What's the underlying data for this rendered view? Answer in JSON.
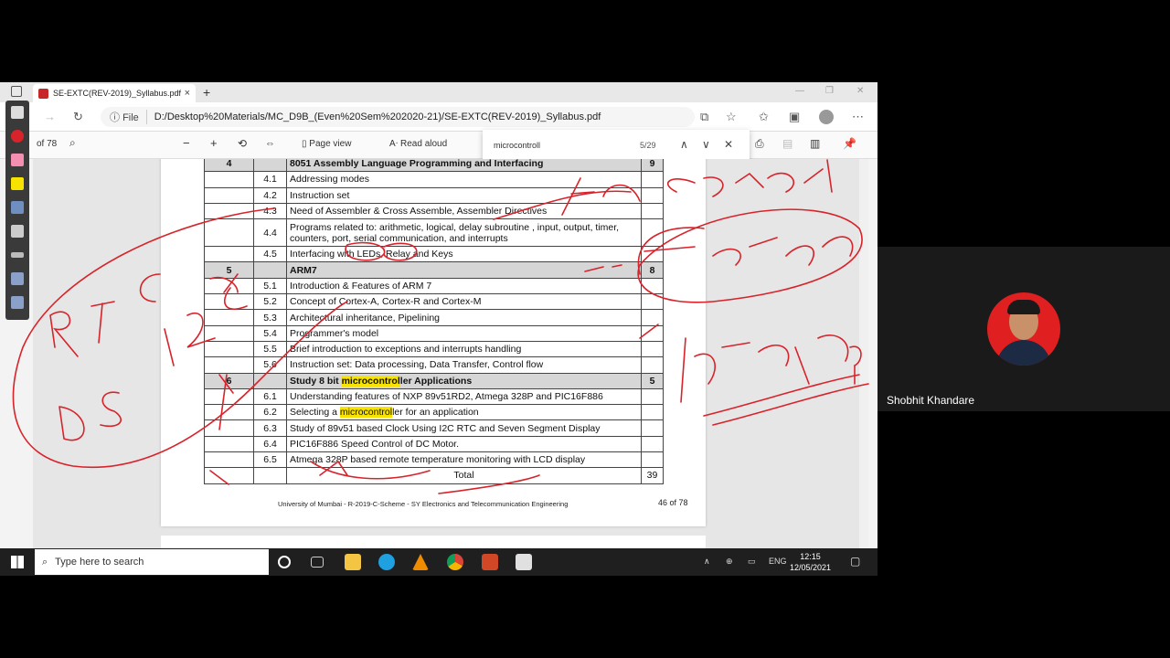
{
  "browser": {
    "tab_title": "SE-EXTC(REV-2019)_Syllabus.pdf",
    "tab_close": "×",
    "new_tab": "+",
    "url_prefix": "File",
    "url": "D:/Desktop%20Materials/MC_D9B_(Even%20Sem%202020-21)/SE-EXTC(REV-2019)_Syllabus.pdf"
  },
  "pdf_toolbar": {
    "page_total": "of 78",
    "page_view": "Page view",
    "read_aloud": "Read aloud"
  },
  "find": {
    "query": "microcontroll",
    "count": "5/29"
  },
  "syllabus": {
    "module4": {
      "no": "4",
      "title": "8051 Assembly Language Programming and Interfacing",
      "hours": "9"
    },
    "rows4": [
      {
        "no": "4.1",
        "text": "Addressing modes"
      },
      {
        "no": "4.2",
        "text": "Instruction set"
      },
      {
        "no": "4.3",
        "text": "Need of Assembler & Cross Assemble, Assembler Directives"
      },
      {
        "no": "4.4",
        "text": "Programs related to: arithmetic, logical, delay subroutine , input, output, timer, counters, port, serial communication, and interrupts"
      },
      {
        "no": "4.5",
        "text": "Interfacing with LEDs, Relay and Keys"
      }
    ],
    "module5": {
      "no": "5",
      "title": "ARM7",
      "hours": "8"
    },
    "rows5": [
      {
        "no": "5.1",
        "text": "Introduction & Features of ARM 7"
      },
      {
        "no": "5.2",
        "text": "Concept of Cortex-A, Cortex-R and Cortex-M"
      },
      {
        "no": "5.3",
        "text": "Architectural inheritance, Pipelining"
      },
      {
        "no": "5.4",
        "text": "Programmer's model"
      },
      {
        "no": "5.5",
        "text": "Brief introduction to exceptions and interrupts handling"
      },
      {
        "no": "5.6",
        "text": "Instruction set: Data processing, Data Transfer, Control flow"
      }
    ],
    "module6": {
      "no": "6",
      "title_pre": "Study 8 bit ",
      "title_hl": "microcontrol",
      "title_post": "ler Applications",
      "hours": "5"
    },
    "rows6": [
      {
        "no": "6.1",
        "text": "Understanding features of NXP 89v51RD2, Atmega 328P and PIC16F886"
      },
      {
        "no": "6.2",
        "text_pre": "Selecting a ",
        "text_hl": "microcontrol",
        "text_post": "ler for an application"
      },
      {
        "no": "6.3",
        "text": "Study of 89v51 based Clock Using I2C RTC and Seven Segment Display"
      },
      {
        "no": "6.4",
        "text": "PIC16F886 Speed Control of DC Motor."
      },
      {
        "no": "6.5",
        "text": "Atmega 328P based remote temperature monitoring with LCD display"
      }
    ],
    "total_label": "Total",
    "total_hours": "39",
    "footer": "University of Mumbai - R-2019-C-Scheme - SY Electronics and Telecommunication Engineering",
    "page_label": "46 of 78"
  },
  "taskbar": {
    "search_placeholder": "Type here to search",
    "lang": "ENG",
    "time": "12:15",
    "date": "12/05/2021"
  },
  "video": {
    "participant_name": "Shobhit Khandare"
  },
  "colors": {
    "ink": "#d8232a",
    "highlight": "#f7e200",
    "avatar_bg": "#e02020"
  }
}
